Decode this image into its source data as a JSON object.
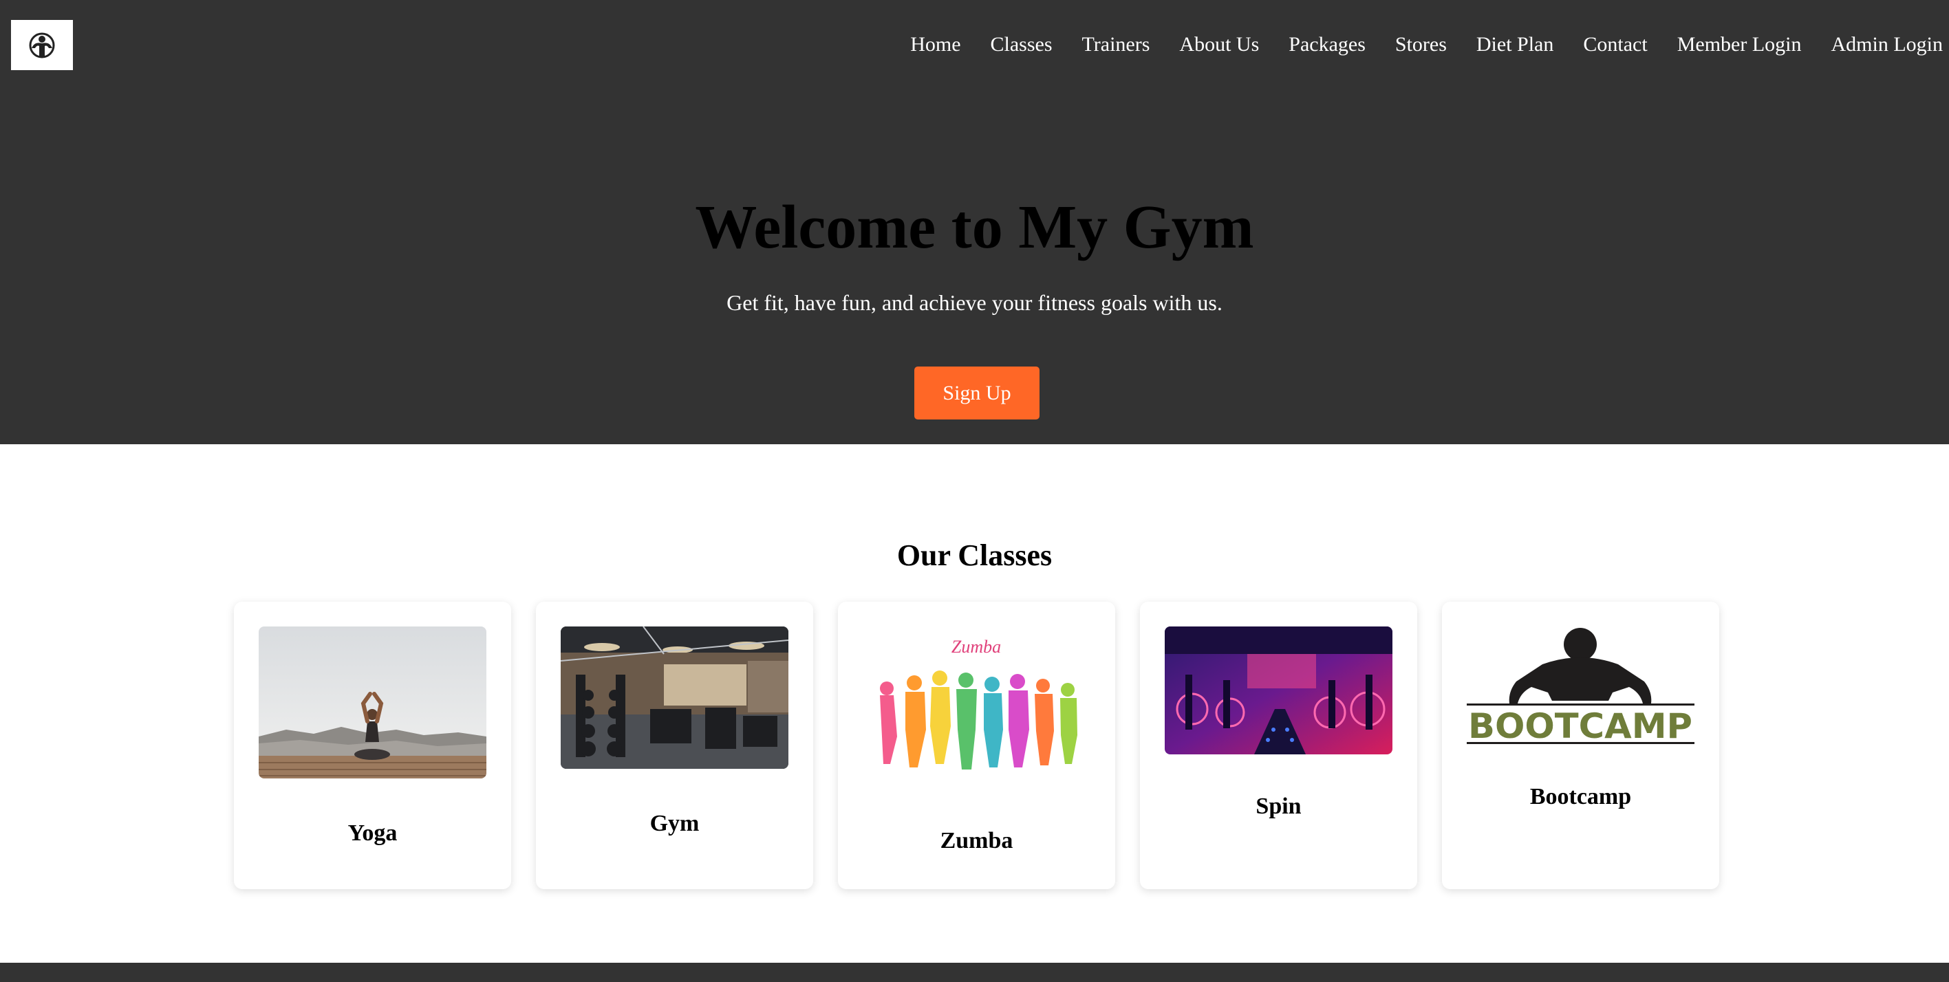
{
  "header": {
    "logo_icon": "gym-logo-icon",
    "nav": [
      "Home",
      "Classes",
      "Trainers",
      "About Us",
      "Packages",
      "Stores",
      "Diet Plan",
      "Contact",
      "Member Login",
      "Admin Login"
    ]
  },
  "hero": {
    "title": "Welcome to My Gym",
    "subtitle": "Get fit, have fun, and achieve your fitness goals with us.",
    "cta_label": "Sign Up"
  },
  "classes": {
    "title": "Our Classes",
    "items": [
      {
        "name": "Yoga",
        "image": "yoga-photo"
      },
      {
        "name": "Gym",
        "image": "gym-interior-photo"
      },
      {
        "name": "Zumba",
        "image": "zumba-dancers-illustration",
        "image_text": "Zumba"
      },
      {
        "name": "Spin",
        "image": "spin-studio-photo"
      },
      {
        "name": "Bootcamp",
        "image": "bootcamp-logo",
        "image_text": "BOOTCAMP"
      }
    ]
  },
  "colors": {
    "header_bg": "#333333",
    "accent": "#ff6726",
    "page_bg": "#ffffff"
  }
}
